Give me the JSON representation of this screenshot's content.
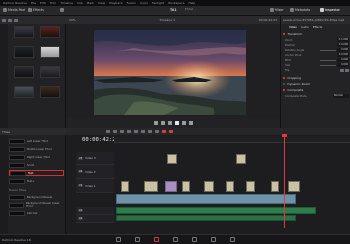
{
  "menubar": {
    "items": [
      "DaVinci Resolve",
      "File",
      "Edit",
      "Trim",
      "Timeline",
      "Clip",
      "Mark",
      "View",
      "Playback",
      "Fusion",
      "Color",
      "Fairlight",
      "Workspace",
      "Help"
    ]
  },
  "toolbar": {
    "media_pool_label": "Media Pool",
    "effects_label": "Effects",
    "project_title": "TA1",
    "edited_label": "Edited",
    "mixer_label": "Mixer",
    "metadata_label": "Metadata",
    "inspector_label": "Inspector"
  },
  "viewer": {
    "zoom": "29%",
    "timeline_name": "Timeline 1",
    "timecode": "00:00:42:23"
  },
  "inspector": {
    "filename": "pexels-vimeo-857056-1280x720-30fps.mp4",
    "tabs": [
      "Video",
      "Audio",
      "Effects"
    ],
    "sections": {
      "transform": "Transform",
      "cropping": "Cropping",
      "dynamic_zoom": "Dynamic Zoom",
      "composite": "Composite",
      "composite_mode_label": "Composite Mode",
      "composite_mode_value": "Normal"
    },
    "rows": [
      {
        "label": "Zoom",
        "value": "X 1.000"
      },
      {
        "label": "Position",
        "value": "X 0.000"
      },
      {
        "label": "Rotation Angle",
        "value": "0.000"
      },
      {
        "label": "Anchor Point",
        "value": "X 0.000"
      },
      {
        "label": "Pitch",
        "value": "0.000"
      },
      {
        "label": "Yaw",
        "value": "0.000"
      },
      {
        "label": "Flip",
        "value": ""
      }
    ]
  },
  "effects": {
    "title": "Titles",
    "items": [
      "Left Lower Third",
      "Middle Lower Third",
      "Right Lower Third",
      "Scroll",
      "Text",
      "Text+"
    ],
    "selected_index": 4,
    "fusion_group": "Fusion Titles",
    "fusion_items": [
      "Background Reveal",
      "Background Reveal Lower Third",
      "Call Out"
    ]
  },
  "timeline": {
    "timecode": "00:00:42:23",
    "tracks": [
      {
        "badge": "V3",
        "name": "Video 3"
      },
      {
        "badge": "V2",
        "name": "Video 2"
      },
      {
        "badge": "V1",
        "name": "Video 1"
      },
      {
        "badge": "A1",
        "name": ""
      },
      {
        "badge": "A2",
        "name": ""
      }
    ]
  },
  "footer": {
    "brand": "DaVinci Resolve 16"
  },
  "colors": {
    "accent": "#e03a3a",
    "clip_video": "#c9c2a3",
    "clip_blue": "#6d93a8",
    "clip_purple": "#a78fbf",
    "audio": "#2f7d4c"
  }
}
